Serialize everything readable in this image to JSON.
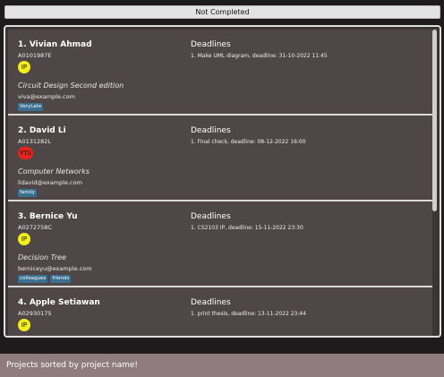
{
  "filter_button": {
    "label": "Not Completed"
  },
  "students": [
    {
      "name": "1.  Vivian Ahmad",
      "id": "A0101987E",
      "status": "IP",
      "status_color": "#f2ee1c",
      "project": "Circuit Design Second edition",
      "email": "viva@example.com",
      "tags": [
        "VeryLate"
      ],
      "deadlines_title": "Deadlines",
      "deadline": "1. Make UML diagram, deadline: 31-10-2022 11:45"
    },
    {
      "name": "2.  David Li",
      "id": "A0131282L",
      "status": "YTS",
      "status_color": "#e8231d",
      "project": "Computer Networks",
      "email": "lidavid@example.com",
      "tags": [
        "family"
      ],
      "deadlines_title": "Deadlines",
      "deadline": "1. Final check, deadline: 08-12-2022 16:00"
    },
    {
      "name": "3.  Bernice Yu",
      "id": "A0272758C",
      "status": "IP",
      "status_color": "#f2ee1c",
      "project": "Decision Tree",
      "email": "berniceyu@example.com",
      "tags": [
        "colleagues",
        "friends"
      ],
      "deadlines_title": "Deadlines",
      "deadline": "1. CS2103 IP, deadline: 15-11-2022 23:30"
    },
    {
      "name": "4.  Apple Setiawan",
      "id": "A0293017S",
      "status": "IP",
      "status_color": "#f2ee1c",
      "project": "",
      "email": "",
      "tags": [],
      "deadlines_title": "Deadlines",
      "deadline": "1. print thesis, deadline: 13-11-2022 23:44"
    }
  ],
  "status_message": "Projects sorted by project name!"
}
